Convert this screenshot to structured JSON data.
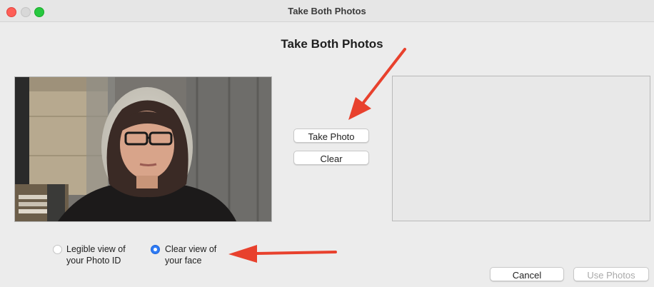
{
  "window": {
    "title": "Take Both Photos"
  },
  "heading": "Take Both Photos",
  "buttons": {
    "take_photo": "Take Photo",
    "clear": "Clear",
    "cancel": "Cancel",
    "use_photos": "Use Photos"
  },
  "radios": {
    "photo_id": {
      "line1": "Legible view of",
      "line2": "your Photo ID",
      "selected": false
    },
    "face": {
      "line1": "Clear view of",
      "line2": "your face",
      "selected": true
    }
  },
  "colors": {
    "annotation_arrow": "#e8412d",
    "radio_selected": "#2f7bf5",
    "close_button": "#fe5f57",
    "maximize_button": "#28c840"
  }
}
